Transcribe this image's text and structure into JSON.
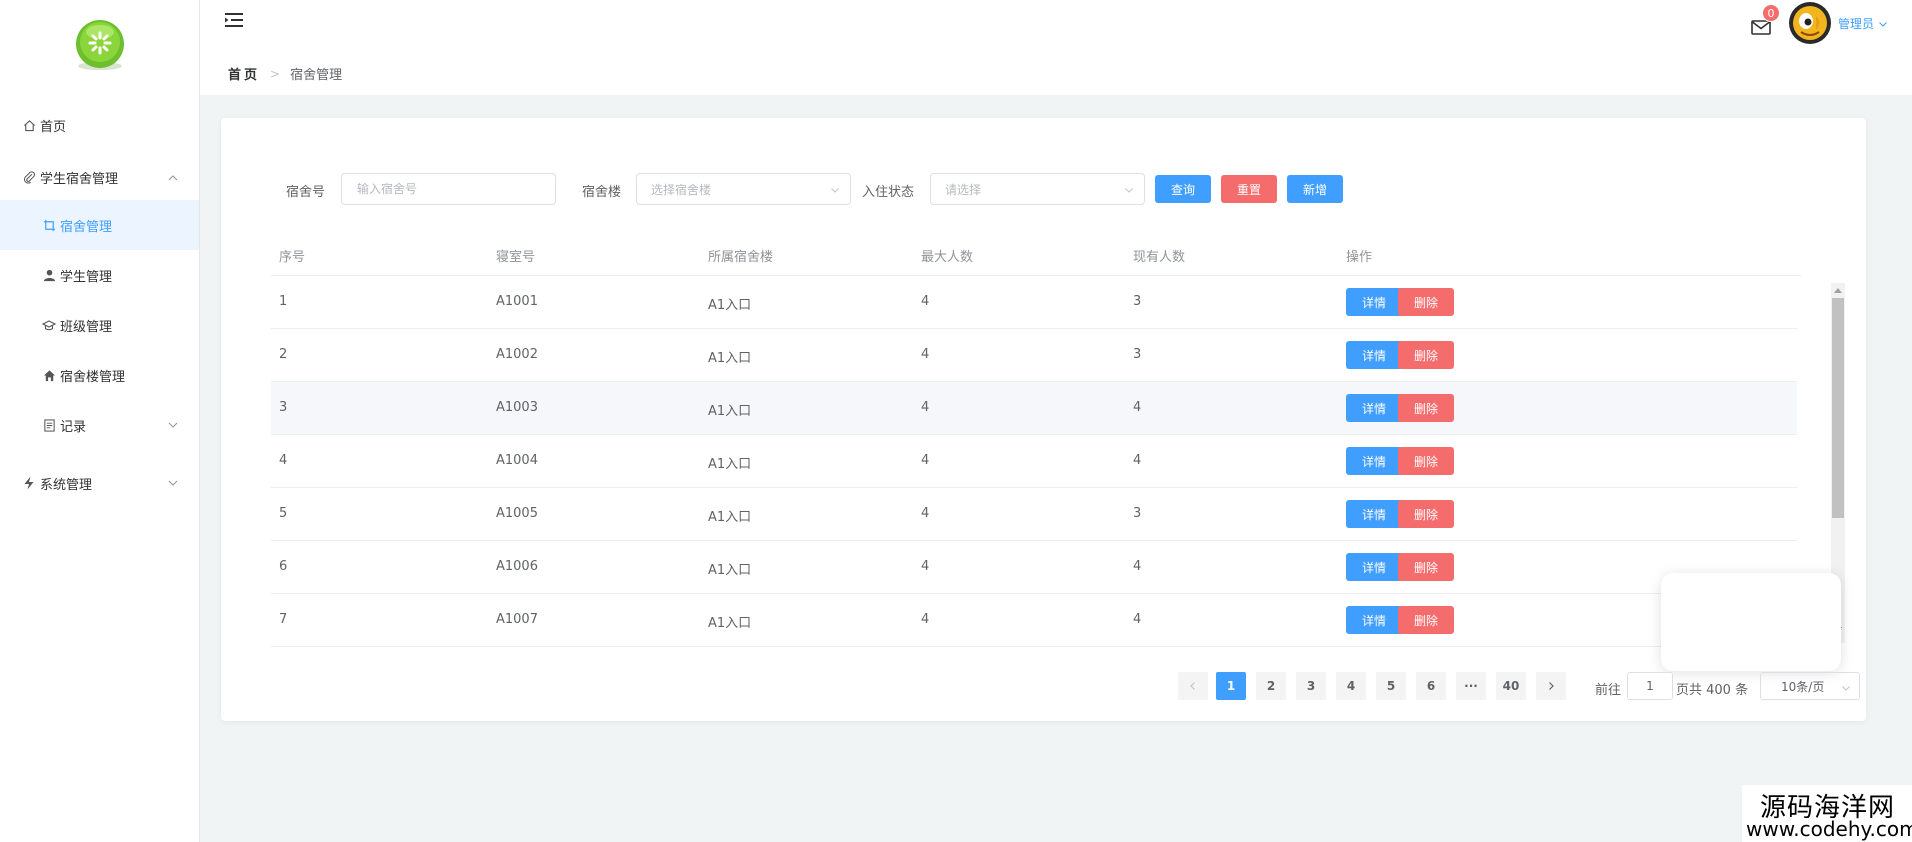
{
  "sidebar": {
    "items": [
      {
        "label": "首页",
        "icon": "home-icon"
      },
      {
        "label": "学生宿舍管理",
        "icon": "paperclip-icon",
        "expanded": true
      },
      {
        "label": "宿舍管理",
        "icon": "crop-icon",
        "active": true
      },
      {
        "label": "学生管理",
        "icon": "user-icon"
      },
      {
        "label": "班级管理",
        "icon": "graduation-cap-icon"
      },
      {
        "label": "宿舍楼管理",
        "icon": "house-icon"
      },
      {
        "label": "记录",
        "icon": "document-icon"
      },
      {
        "label": "系统管理",
        "icon": "lightning-icon"
      }
    ]
  },
  "header": {
    "breadcrumb": {
      "home": "首页",
      "current": "宿舍管理"
    },
    "notifications": "0",
    "username": "管理员"
  },
  "filter": {
    "dorm_no_label": "宿舍号",
    "dorm_no_placeholder": "输入宿舍号",
    "building_label": "宿舍楼",
    "building_placeholder": "选择宿舍楼",
    "status_label": "入住状态",
    "status_placeholder": "请选择",
    "query": "查询",
    "reset": "重置",
    "add": "新增"
  },
  "table": {
    "columns": [
      "序号",
      "寝室号",
      "所属宿舍楼",
      "最大人数",
      "现有人数",
      "操作"
    ],
    "detail_label": "详情",
    "delete_label": "删除",
    "rows": [
      [
        "1",
        "A1001",
        "A1入口",
        "4",
        "3"
      ],
      [
        "2",
        "A1002",
        "A1入口",
        "4",
        "3"
      ],
      [
        "3",
        "A1003",
        "A1入口",
        "4",
        "4"
      ],
      [
        "4",
        "A1004",
        "A1入口",
        "4",
        "4"
      ],
      [
        "5",
        "A1005",
        "A1入口",
        "4",
        "3"
      ],
      [
        "6",
        "A1006",
        "A1入口",
        "4",
        "4"
      ],
      [
        "7",
        "A1007",
        "A1入口",
        "4",
        "4"
      ]
    ]
  },
  "pagination": {
    "pages": [
      "1",
      "2",
      "3",
      "4",
      "5",
      "6",
      "···",
      "40"
    ],
    "current": "1",
    "goto_label": "前往",
    "goto_value": "1",
    "total_text": "页共 400 条",
    "page_size": "10条/页"
  },
  "watermark": {
    "line1": "源码海洋网",
    "line2": "www.codehy.com"
  },
  "colors": {
    "primary": "#409eff",
    "danger": "#f56c6c"
  }
}
